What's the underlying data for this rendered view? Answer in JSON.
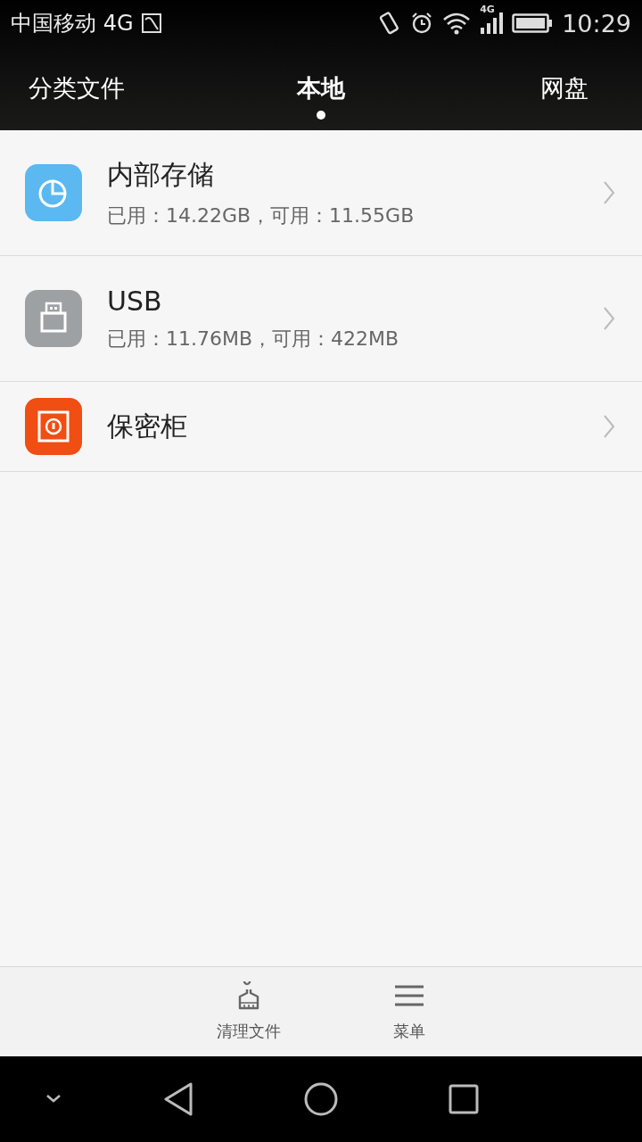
{
  "status_bar": {
    "carrier": "中国移动 4G",
    "network_label": "4G",
    "time": "10:29"
  },
  "tabs": [
    {
      "label": "分类文件",
      "selected": false
    },
    {
      "label": "本地",
      "selected": true
    },
    {
      "label": "网盘",
      "selected": false
    }
  ],
  "storage_list": [
    {
      "kind": "internal",
      "title": "内部存储",
      "subtitle": "已用：14.22GB，可用：11.55GB",
      "color": "#5bb8f0"
    },
    {
      "kind": "usb",
      "title": "USB",
      "subtitle": "已用：11.76MB，可用：422MB",
      "color": "#9ea1a4"
    },
    {
      "kind": "safe",
      "title": "保密柜",
      "color": "#f04e12"
    }
  ],
  "toolbar": [
    {
      "kind": "clean",
      "label": "清理文件"
    },
    {
      "kind": "menu",
      "label": "菜单"
    }
  ]
}
